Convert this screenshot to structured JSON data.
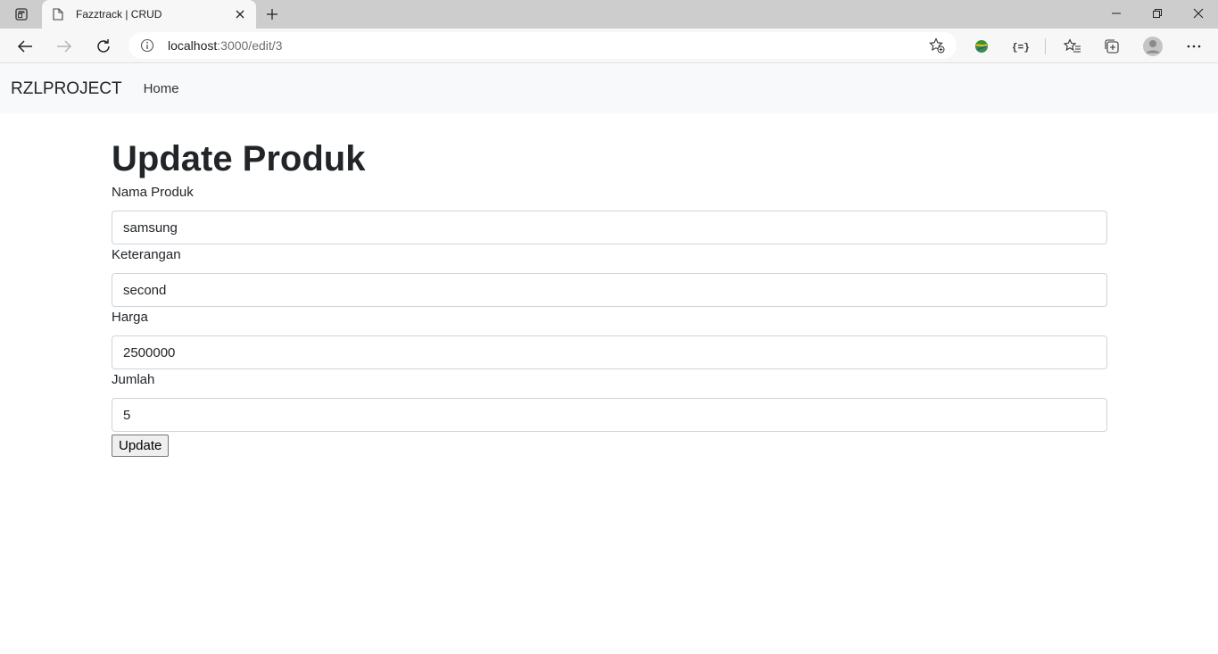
{
  "browser": {
    "tab_title": "Fazztrack | CRUD",
    "url_host": "localhost",
    "url_path": ":3000/edit/3"
  },
  "navbar": {
    "brand": "RZLPROJECT",
    "home_link": "Home"
  },
  "form": {
    "heading": "Update Produk",
    "fields": [
      {
        "label": "Nama Produk",
        "value": "samsung"
      },
      {
        "label": "Keterangan",
        "value": "second"
      },
      {
        "label": "Harga",
        "value": "2500000"
      },
      {
        "label": "Jumlah",
        "value": "5"
      }
    ],
    "submit_label": "Update"
  },
  "icons": {
    "tab_actions": "tab-actions-icon",
    "favicon": "page-icon",
    "tab_close": "close-icon",
    "new_tab": "plus-icon",
    "back": "back-arrow-icon",
    "forward": "forward-arrow-icon",
    "refresh": "refresh-icon",
    "site_info": "info-icon",
    "favorite_add": "star-add-icon",
    "extension_1": "extension-globe-icon",
    "extension_2": "extension-braces-icon",
    "favorites": "favorites-icon",
    "collections": "collections-icon",
    "profile": "profile-avatar-icon",
    "menu": "more-icon"
  }
}
